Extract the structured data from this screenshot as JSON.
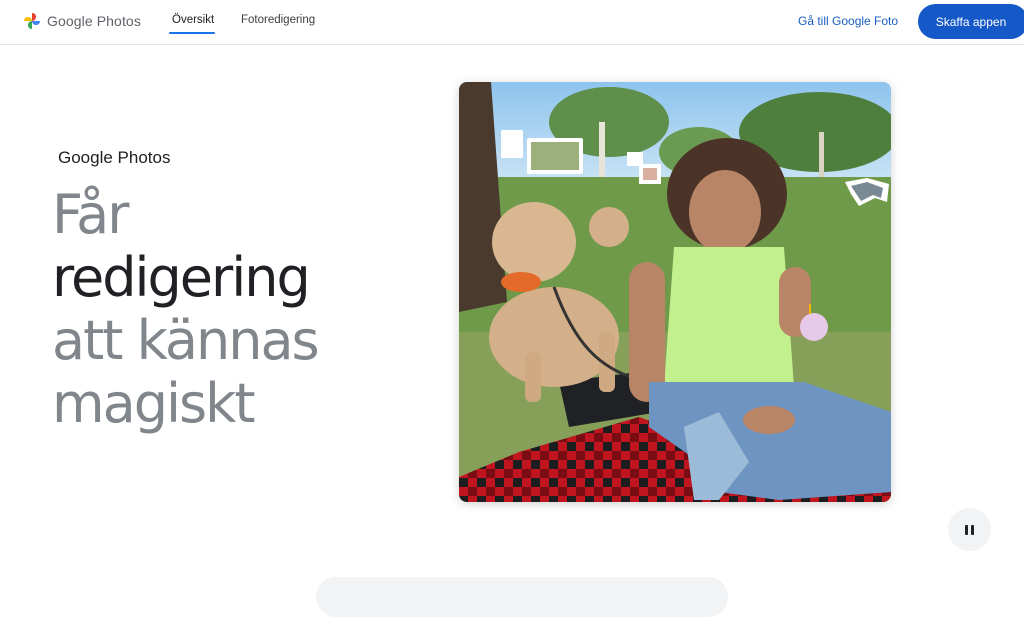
{
  "header": {
    "logo_text": "Google Photos",
    "tabs": [
      {
        "label": "Översikt",
        "active": true
      },
      {
        "label": "Fotoredigering",
        "active": false
      }
    ],
    "goto_link": "Gå till Google Foto",
    "cta": "Skaffa appen"
  },
  "hero": {
    "brand": "Google Photos",
    "headline": [
      "Får",
      "redigering",
      "att kännas",
      "magiskt"
    ]
  },
  "media": {
    "pause_icon": "pause-icon"
  },
  "colors": {
    "accent": "#1a73e8",
    "cta_bg": "#1558c7",
    "headline_gray": "#80868b",
    "headline_dark": "#202124"
  }
}
